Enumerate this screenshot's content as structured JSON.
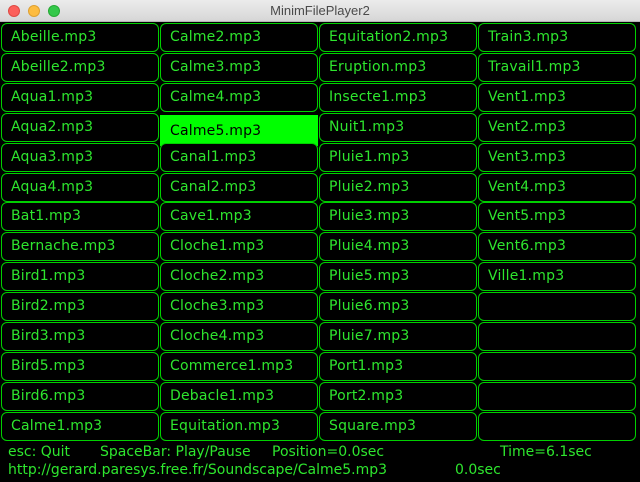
{
  "window": {
    "title": "MinimFilePlayer2"
  },
  "columns": [
    [
      "Abeille.mp3",
      "Abeille2.mp3",
      "Aqua1.mp3",
      "Aqua2.mp3",
      "Aqua3.mp3",
      "Aqua4.mp3",
      "Bat1.mp3",
      "Bernache.mp3",
      "Bird1.mp3",
      "Bird2.mp3",
      "Bird3.mp3",
      "Bird5.mp3",
      "Bird6.mp3",
      "Calme1.mp3"
    ],
    [
      "Calme2.mp3",
      "Calme3.mp3",
      "Calme4.mp3",
      "Calme5.mp3",
      "Canal1.mp3",
      "Canal2.mp3",
      "Cave1.mp3",
      "Cloche1.mp3",
      "Cloche2.mp3",
      "Cloche3.mp3",
      "Cloche4.mp3",
      "Commerce1.mp3",
      "Debacle1.mp3",
      "Equitation.mp3"
    ],
    [
      "Equitation2.mp3",
      "Eruption.mp3",
      "Insecte1.mp3",
      "Nuit1.mp3",
      "Pluie1.mp3",
      "Pluie2.mp3",
      "Pluie3.mp3",
      "Pluie4.mp3",
      "Pluie5.mp3",
      "Pluie6.mp3",
      "Pluie7.mp3",
      "Port1.mp3",
      "Port2.mp3",
      "Square.mp3"
    ],
    [
      "Train3.mp3",
      "Travail1.mp3",
      "Vent1.mp3",
      "Vent2.mp3",
      "Vent3.mp3",
      "Vent4.mp3",
      "Vent5.mp3",
      "Vent6.mp3",
      "Ville1.mp3",
      "",
      "",
      "",
      "",
      ""
    ]
  ],
  "active": {
    "column": 1,
    "row": 3
  },
  "status": {
    "esc": "esc: Quit",
    "space": "SpaceBar: Play/Pause",
    "position": "Position=0.0sec",
    "time": "Time=6.1sec",
    "url": "http://gerard.paresys.free.fr/Soundscape/Calme5.mp3",
    "url_time": "0.0sec"
  },
  "colors": {
    "accent": "#00ff00",
    "text": "#2ee62e",
    "background": "#000000"
  }
}
